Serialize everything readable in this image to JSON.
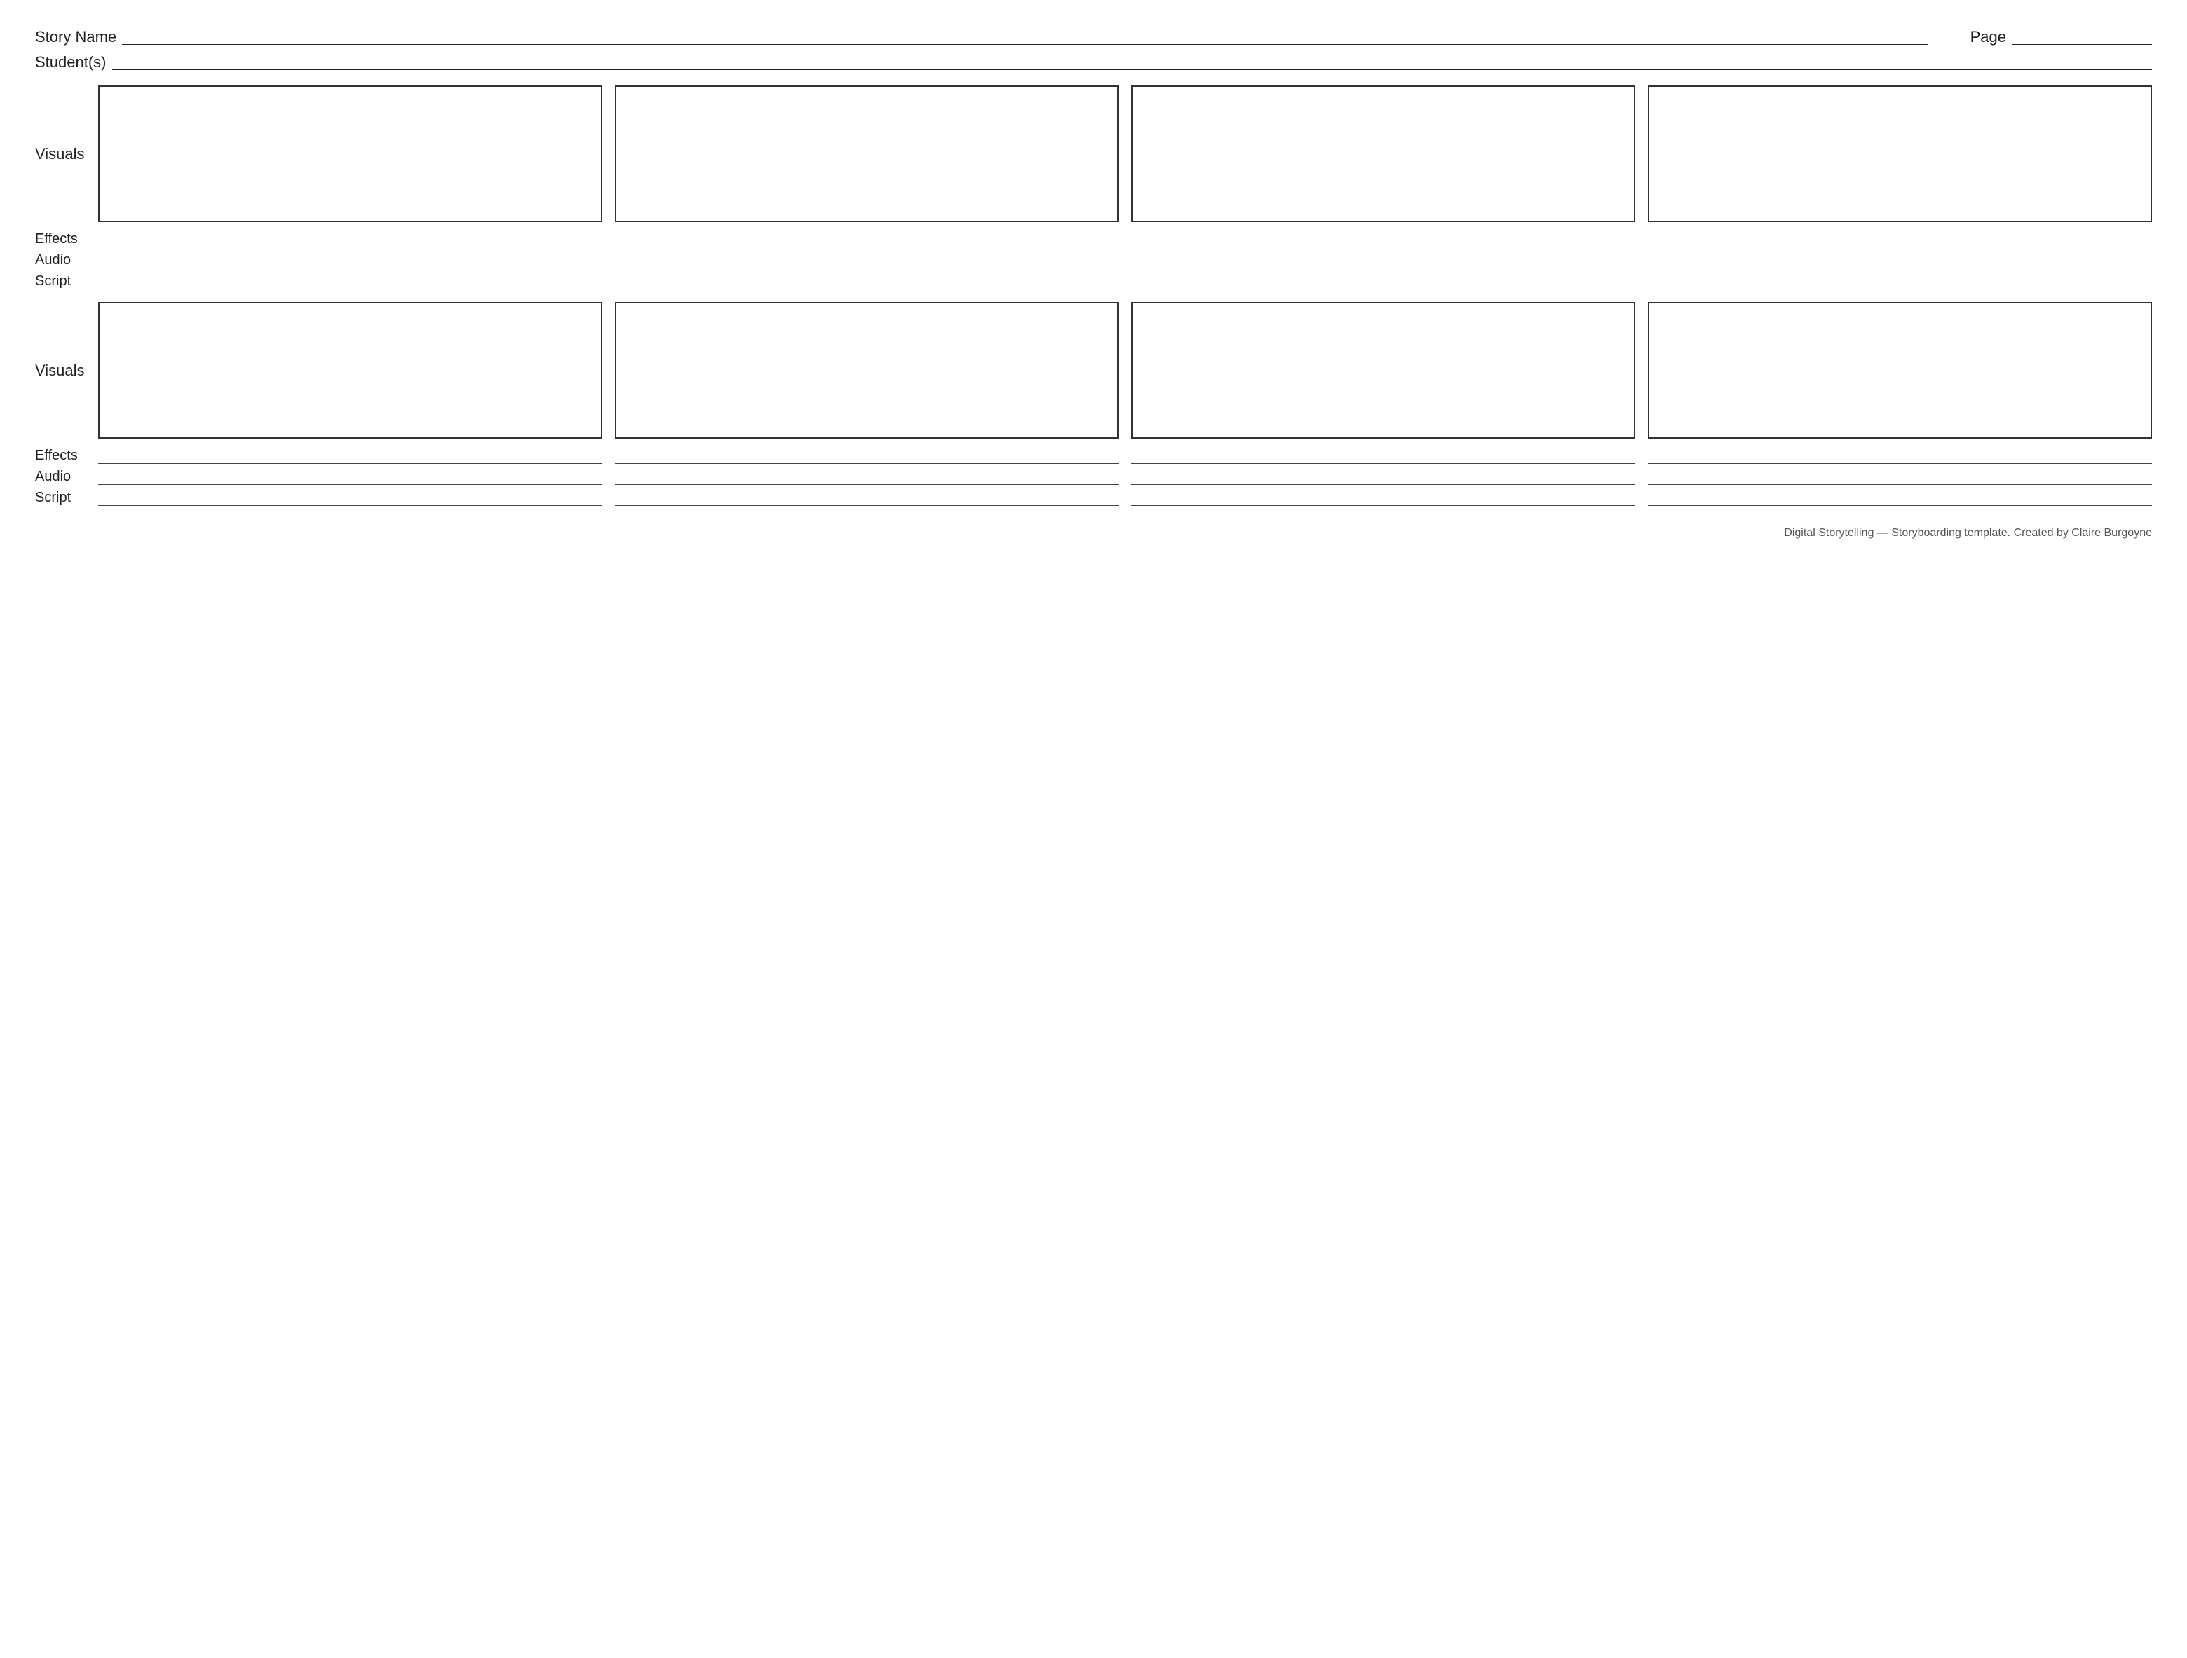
{
  "header": {
    "story_name_label": "Story Name",
    "page_label": "Page",
    "students_label": "Student(s)"
  },
  "sections": [
    {
      "id": "section1",
      "visuals_label": "Visuals",
      "effects_label": "Effects",
      "audio_label": "Audio",
      "script_label": "Script",
      "frames_count": 4
    },
    {
      "id": "section2",
      "visuals_label": "Visuals",
      "effects_label": "Effects",
      "audio_label": "Audio",
      "script_label": "Script",
      "frames_count": 4
    }
  ],
  "footer": {
    "text": "Digital Storytelling  —  Storyboarding template. Created by Claire Burgoyne"
  }
}
